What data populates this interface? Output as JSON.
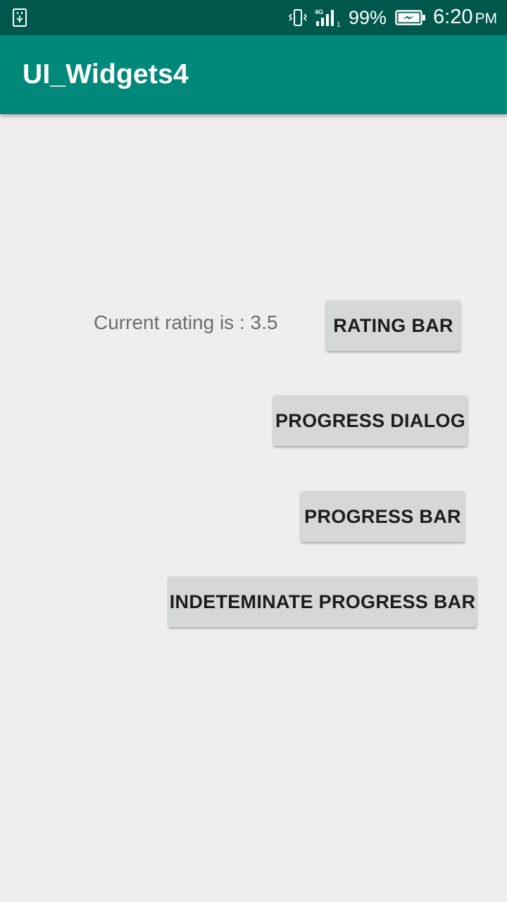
{
  "status_bar": {
    "network": "4G",
    "sim_slot": "1",
    "battery_percent": "99%",
    "time": "6:20",
    "ampm": "PM"
  },
  "app_bar": {
    "title": "UI_Widgets4"
  },
  "content": {
    "rating_text": "Current rating is : 3.5",
    "buttons": {
      "rating_bar": "RATING BAR",
      "progress_dialog": "PROGRESS DIALOG",
      "progress_bar": "PROGRESS BAR",
      "indeterminate_progress_bar": "INDETEMINATE PROGRESS BAR"
    }
  },
  "colors": {
    "status_bar": "#00574b",
    "app_bar": "#00897b",
    "background": "#eeeeee",
    "button": "#d6d7d7"
  }
}
